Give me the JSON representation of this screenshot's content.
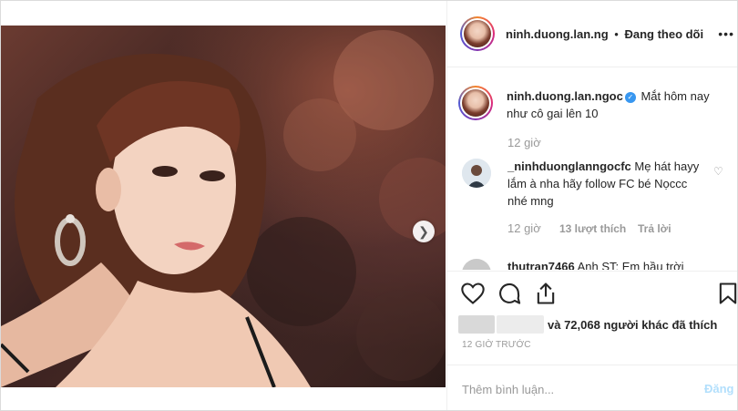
{
  "post": {
    "photo_alt_icon": "photo",
    "carousel": {
      "slides": 3,
      "active_index": 0
    }
  },
  "header": {
    "username": "ninh.duong.lan.ng",
    "separator": "•",
    "follow_status": "Đang theo dõi",
    "more_icon": "ellipsis-icon"
  },
  "caption": {
    "username": "ninh.duong.lan.ngoc",
    "verified_icon": "verified-badge-icon",
    "text": "Mắt hôm nay như cô gai lên 10",
    "time": "12 giờ"
  },
  "comments": [
    {
      "username": "_ninhduonglanngocfc",
      "text": "Mẹ hát hayy lắm à nha hãy follow FC bé Nọccc nhé mng",
      "time": "12 giờ",
      "likes": "13 lượt thích",
      "reply": "Trả lời"
    },
    {
      "username": "thutran7466",
      "text": "Anh ST: Em hầu trời"
    }
  ],
  "actions": {
    "like_icon": "heart-icon",
    "comment_icon": "comment-icon",
    "share_icon": "share-icon",
    "save_icon": "bookmark-icon"
  },
  "likes": {
    "text": "và 72,068 người khác đã thích"
  },
  "post_time": "12 GIỜ TRƯỚC",
  "comment_box": {
    "placeholder": "Thêm bình luận...",
    "post_label": "Đăng"
  },
  "colors": {
    "accent": "#3897f0",
    "post_button_disabled": "#b2dffc",
    "secondary_text": "#999999"
  }
}
